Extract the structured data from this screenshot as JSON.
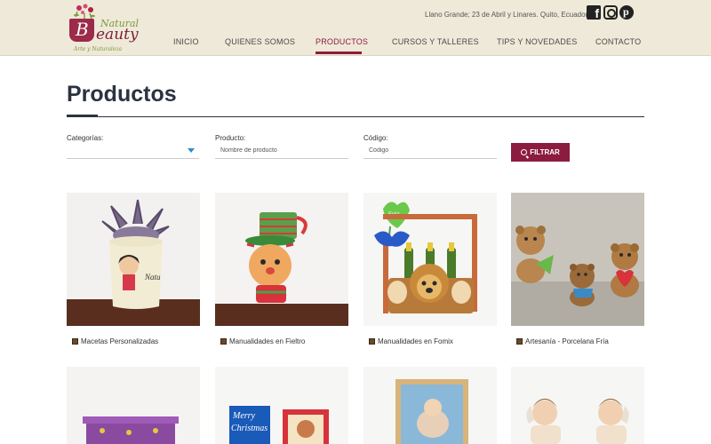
{
  "header": {
    "logo": {
      "natural": "Natural",
      "beauty": "eauty",
      "initial": "B",
      "tagline": "Arte y Naturaleza"
    },
    "address": "Llano Grande; 23 de Abril y Linares. Quito, Ecuador.",
    "social": [
      "facebook-icon",
      "instagram-icon",
      "pinterest-icon"
    ]
  },
  "nav": [
    {
      "label": "INICIO"
    },
    {
      "label": "QUIENES SOMOS"
    },
    {
      "label": "PRODUCTOS",
      "active": true
    },
    {
      "label": "CURSOS Y TALLERES"
    },
    {
      "label": "TIPS Y NOVEDADES"
    },
    {
      "label": "CONTACTO"
    }
  ],
  "page": {
    "title": "Productos"
  },
  "filters": {
    "categorias_label": "Categorías:",
    "categorias_value": "",
    "producto_label": "Producto:",
    "producto_placeholder": "Nombre de producto",
    "codigo_label": "Código:",
    "codigo_placeholder": "Código",
    "button_label": "FILTRAR"
  },
  "products": [
    {
      "label": "Macetas Personalizadas"
    },
    {
      "label": "Manualidades en Fieltro"
    },
    {
      "label": "Manualidades en Fomix"
    },
    {
      "label": "Artesanía - Porcelana Fría"
    }
  ],
  "colors": {
    "accent": "#8c1c3f",
    "header_bg": "#efe9d9",
    "title": "#2a3340"
  }
}
